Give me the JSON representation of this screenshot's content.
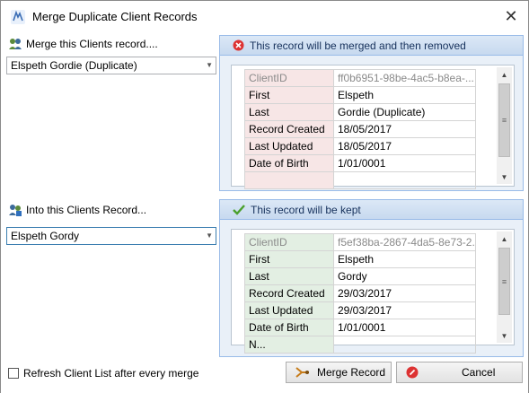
{
  "window": {
    "title": "Merge Duplicate Client Records",
    "close_glyph": "✕"
  },
  "left": {
    "merge_label": "Merge this Clients record....",
    "merge_value": "Elspeth Gordie (Duplicate)",
    "into_label": "Into this Clients Record...",
    "into_value": "Elspeth Gordy"
  },
  "panels": {
    "remove": {
      "header": "This record will be merged and then removed",
      "rows": [
        {
          "key": "ClientID",
          "value": "ff0b6951-98be-4ac5-b8ea-..."
        },
        {
          "key": "First",
          "value": "Elspeth"
        },
        {
          "key": "Last",
          "value": "Gordie (Duplicate)"
        },
        {
          "key": "Record Created",
          "value": "18/05/2017"
        },
        {
          "key": "Last Updated",
          "value": "18/05/2017"
        },
        {
          "key": "Date of Birth",
          "value": "1/01/0001"
        },
        {
          "key": "",
          "value": ""
        }
      ]
    },
    "keep": {
      "header": "This record will be kept",
      "rows": [
        {
          "key": "ClientID",
          "value": "f5ef38ba-2867-4da5-8e73-2..."
        },
        {
          "key": "First",
          "value": "Elspeth"
        },
        {
          "key": "Last",
          "value": "Gordy"
        },
        {
          "key": "Record Created",
          "value": "29/03/2017"
        },
        {
          "key": "Last Updated",
          "value": "29/03/2017"
        },
        {
          "key": "Date of Birth",
          "value": "1/01/0001"
        },
        {
          "key": "N...",
          "value": ""
        }
      ]
    }
  },
  "bottom": {
    "refresh_label": "Refresh Client List after every merge",
    "merge_button": "Merge Record",
    "cancel_button": "Cancel"
  },
  "colors": {
    "panel_border": "#99bbe8",
    "remove_key_bg": "#f7e6e6",
    "keep_key_bg": "#e3efe3",
    "cancel_icon": "#d33",
    "check_icon": "#4aa02c"
  }
}
